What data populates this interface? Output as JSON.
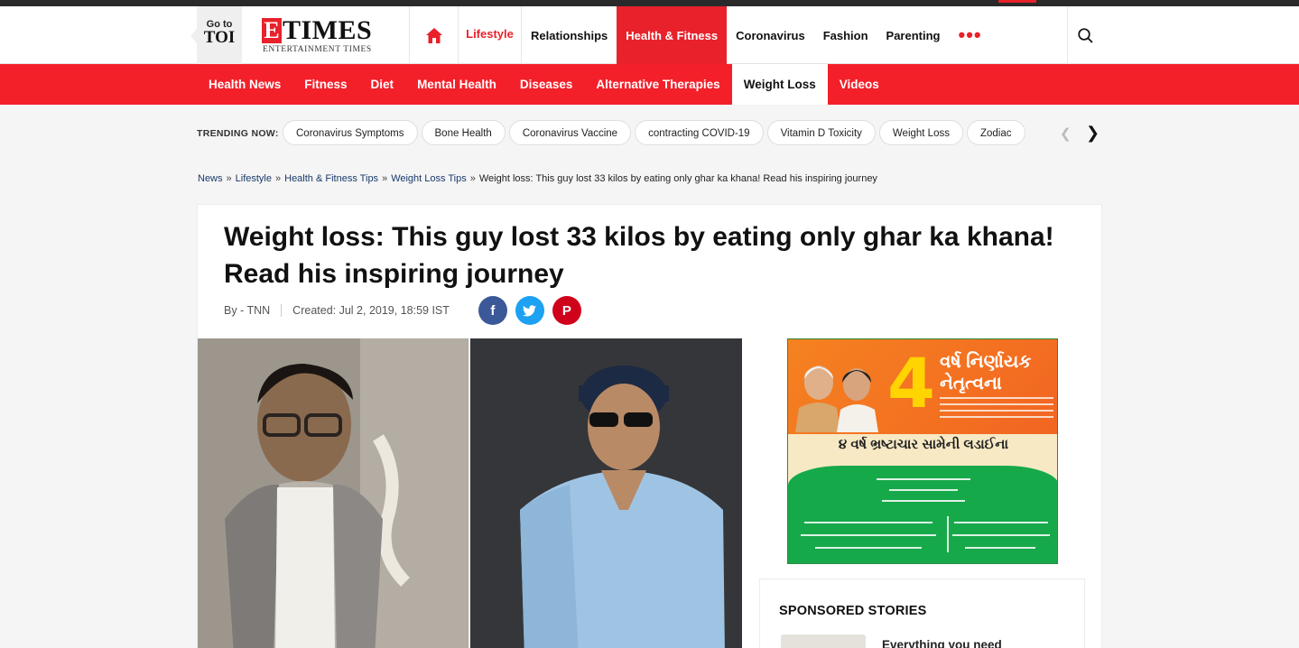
{
  "goto": {
    "small": "Go to",
    "big": "TOI"
  },
  "logo": {
    "e": "E",
    "times": "TIMES",
    "sub": "ENTERTAINMENT TIMES"
  },
  "nav": {
    "lifestyle": "Lifestyle",
    "items": [
      "Relationships",
      "Health & Fitness",
      "Coronavirus",
      "Fashion",
      "Parenting"
    ],
    "more": "•••"
  },
  "subnav": [
    "Health News",
    "Fitness",
    "Diet",
    "Mental Health",
    "Diseases",
    "Alternative Therapies",
    "Weight Loss",
    "Videos"
  ],
  "trending": {
    "label": "TRENDING NOW:",
    "items": [
      "Coronavirus Symptoms",
      "Bone Health",
      "Coronavirus Vaccine",
      "contracting COVID-19",
      "Vitamin D Toxicity",
      "Weight Loss",
      "Zodiac"
    ]
  },
  "breadcrumb": {
    "links": [
      "News",
      "Lifestyle",
      "Health & Fitness Tips",
      "Weight Loss Tips"
    ],
    "current": "Weight loss: This guy lost 33 kilos by eating only ghar ka khana! Read his inspiring journey"
  },
  "article": {
    "headline": "Weight loss: This guy lost 33 kilos by eating only ghar ka khana! Read his inspiring journey",
    "by": "By - TNN",
    "created": "Created: Jul 2, 2019, 18:59 IST"
  },
  "ad": {
    "number": "4",
    "line1": "વર્ષ નિર્ણાયક",
    "line2": "નેતૃત્વના",
    "middle": "૪ વર્ષ ભ્રષ્ટાચાર સામેની લડાઈના"
  },
  "sponsored": {
    "title": "SPONSORED STORIES",
    "story": "Everything you need"
  },
  "colors": {
    "brand_red": "#e8212b",
    "subnav_red": "#f3202a",
    "facebook": "#3b5998",
    "twitter": "#1da1f2",
    "pinterest": "#d0021b"
  }
}
